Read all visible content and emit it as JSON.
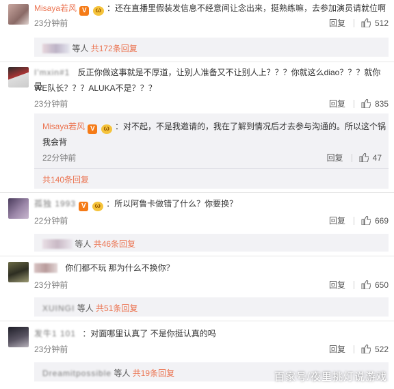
{
  "comments": [
    {
      "username": "Misaya若风",
      "text": "：还在直播里假装发信息不经意间让念出来，挺熟练嘛，去参加演员请就位啊",
      "time": "23分钟前",
      "reply_label": "回复",
      "likes": "512",
      "sub_summary": {
        "prefix": "等人",
        "link": "共172条回复"
      }
    },
    {
      "username": "I'mxin#1",
      "text_line1": "反正你做这事就是不厚道，让别人准备又不让别人上？？？你就这么diao？？？就你是",
      "text_line2": "WE队长？？？ALUKA不是？？？",
      "time": "23分钟前",
      "reply_label": "回复",
      "likes": "835",
      "nested": {
        "username": "Misaya若风",
        "text_line1": "：对不起，不是我邀请的，我在了解到情况后才去参与沟通的。所以这个锅",
        "text_line2": "我会背",
        "time": "22分钟前",
        "reply_label": "回复",
        "likes": "47",
        "summary": "共140条回复"
      }
    },
    {
      "username": "孤独 1993",
      "text": "：所以阿鲁卡做错了什么？你要换？",
      "time": "22分钟前",
      "reply_label": "回复",
      "likes": "669",
      "sub_summary": {
        "prefix": "等人",
        "link": "共46条回复"
      }
    },
    {
      "username": "",
      "text": "你们都不玩 那为什么不换你？",
      "time": "23分钟前",
      "reply_label": "回复",
      "likes": "650",
      "sub_summary": {
        "prefix": "等人",
        "link": "共51条回复"
      }
    },
    {
      "username": "发牛1 101",
      "text": "：对面哪里认真了 不是你挺认真的吗",
      "time": "23分钟前",
      "reply_label": "回复",
      "likes": "522",
      "sub_summary": {
        "prefix": "等人",
        "link": "共19条回复"
      }
    }
  ],
  "sub_names": [
    "",
    "",
    "XUINGI",
    "Dreamitpossible"
  ],
  "watermark": "百家号/夜里挑灯说游戏",
  "colors": {
    "accent": "#eb7350",
    "subbox_bg": "#f2f2f5",
    "meta": "#7d7d7d"
  }
}
